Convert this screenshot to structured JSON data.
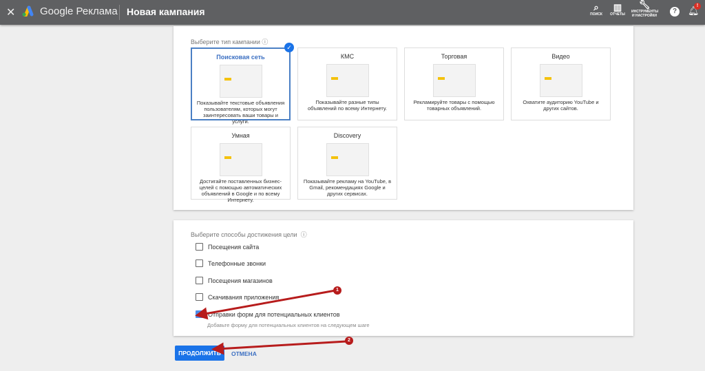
{
  "header": {
    "brand": "Google Реклама",
    "title": "Новая кампания",
    "tools": [
      {
        "label": "ПОИСК",
        "icon": "search-icon"
      },
      {
        "label": "ОТЧЕТЫ",
        "icon": "reports-icon"
      },
      {
        "label": "ИНСТРУМЕНТЫ И НАСТРОЙКИ",
        "icon": "wrench-icon"
      }
    ],
    "notification_count": "!"
  },
  "campaign": {
    "label": "Выберите тип кампании",
    "cards": [
      {
        "title": "Поисковая сеть",
        "desc": "Показывайте текстовые объявления пользователям, которых могут заинтересовать ваши товары и услуги.",
        "selected": true
      },
      {
        "title": "КМС",
        "desc": "Показывайте разные типы объявлений по всему Интернету."
      },
      {
        "title": "Торговая",
        "desc": "Рекламируйте товары с помощью товарных объявлений."
      },
      {
        "title": "Видео",
        "desc": "Охватите аудиторию YouTube и других сайтов."
      },
      {
        "title": "Умная",
        "desc": "Достигайте поставленных бизнес-целей с помощью автоматических объявлений в Google и по всему Интернету."
      },
      {
        "title": "Discovery",
        "desc": "Показывайте рекламу на YouTube, в Gmail, рекомендациях Google и других сервисах."
      }
    ]
  },
  "goals": {
    "label": "Выберите способы достижения цели",
    "options": [
      {
        "label": "Посещения сайта",
        "checked": false
      },
      {
        "label": "Телефонные звонки",
        "checked": false
      },
      {
        "label": "Посещения магазинов",
        "checked": false
      },
      {
        "label": "Скачивания приложения",
        "checked": false
      },
      {
        "label": "Отправки форм для потенциальных клиентов",
        "checked": true
      }
    ],
    "hint": "Добавьте форму для потенциальных клиентов на следующем шаге"
  },
  "actions": {
    "continue": "ПРОДОЛЖИТЬ",
    "cancel": "ОТМЕНА"
  },
  "annotations": [
    "1",
    "2"
  ],
  "colors": {
    "accent": "#1a73e8",
    "arrow": "#b71c1c",
    "topbar": "#5f6062"
  }
}
